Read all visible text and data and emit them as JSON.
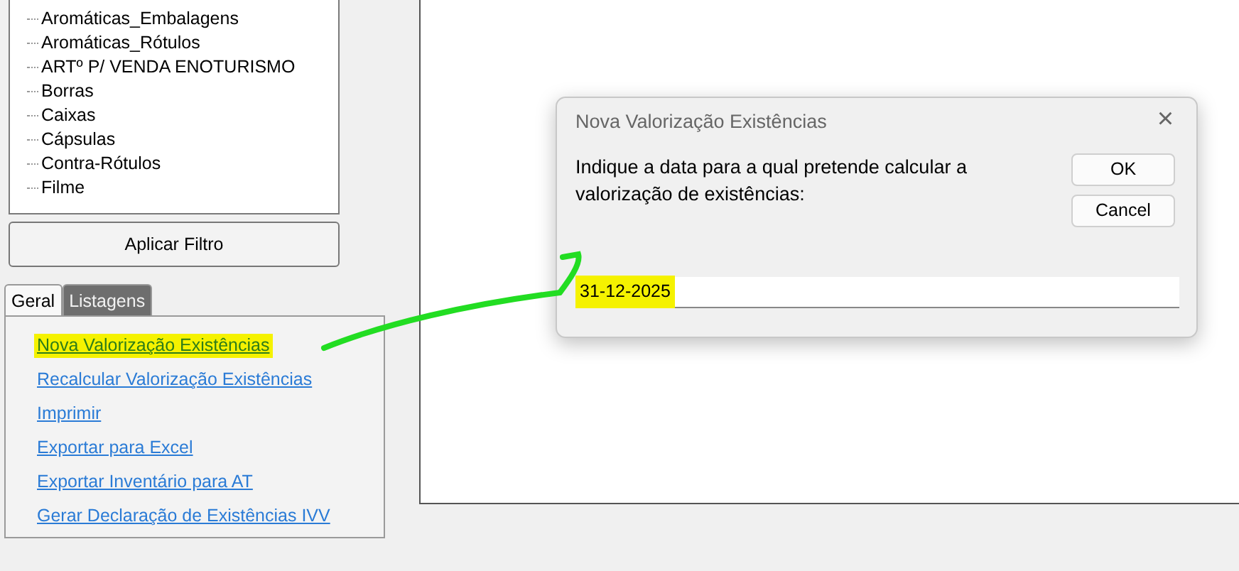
{
  "tree": {
    "items": [
      {
        "label": "Aromáticas_Embalagens"
      },
      {
        "label": "Aromáticas_Rótulos"
      },
      {
        "label": "ARTº P/ VENDA ENOTURISMO"
      },
      {
        "label": "Borras"
      },
      {
        "label": "Caixas"
      },
      {
        "label": "Cápsulas"
      },
      {
        "label": "Contra-Rótulos"
      },
      {
        "label": "Filme"
      }
    ]
  },
  "filter_button": "Aplicar Filtro",
  "tabs": [
    {
      "label": "Geral",
      "selected": true
    },
    {
      "label": "Listagens",
      "selected": false
    }
  ],
  "links": [
    {
      "label": "Nova Valorização Existências",
      "highlighted": true
    },
    {
      "label": "Recalcular Valorização Existências",
      "highlighted": false
    },
    {
      "label": "Imprimir",
      "highlighted": false
    },
    {
      "label": "Exportar para Excel",
      "highlighted": false
    },
    {
      "label": "Exportar Inventário para AT",
      "highlighted": false
    },
    {
      "label": "Gerar Declaração de Existências IVV",
      "highlighted": false
    }
  ],
  "dialog": {
    "title": "Nova Valorização Existências",
    "close": "×",
    "message": "Indique a data para a qual pretende calcular a valorização de existências:",
    "buttons": [
      "OK",
      "Cancel"
    ],
    "input": {
      "value": "31-12-2025",
      "highlighted": true
    }
  }
}
